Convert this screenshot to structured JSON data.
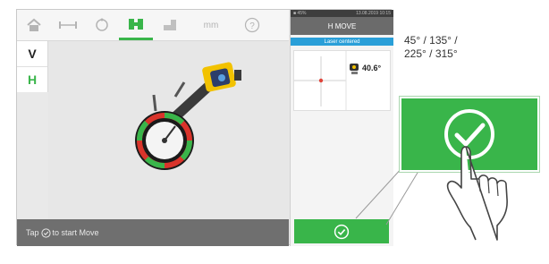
{
  "toolbar": {
    "icons": [
      "home-icon",
      "dimensions-icon",
      "rotate-icon",
      "alignment-move-icon",
      "machine-icon",
      "units-icon",
      "help-icon"
    ],
    "units_label": "mm",
    "active_color": "#39b54a"
  },
  "sidebar": {
    "items": [
      {
        "label": "V",
        "color": "#222222"
      },
      {
        "label": "H",
        "color": "#39b54a"
      }
    ]
  },
  "bottom_bar": {
    "prefix": "Tap",
    "suffix": "to start Move"
  },
  "panel": {
    "status_left": "■ 45%",
    "status_right": "13.08.2019 10:15",
    "title": "H MOVE",
    "banner": "Laser centered",
    "angle_value": "40.6°"
  },
  "annotation": {
    "angles": [
      "45° / 135° /",
      "225° / 315°"
    ]
  },
  "colors": {
    "accent_green": "#39b54a",
    "banner_blue": "#2a9fd8",
    "dial_red": "#d9342b"
  }
}
